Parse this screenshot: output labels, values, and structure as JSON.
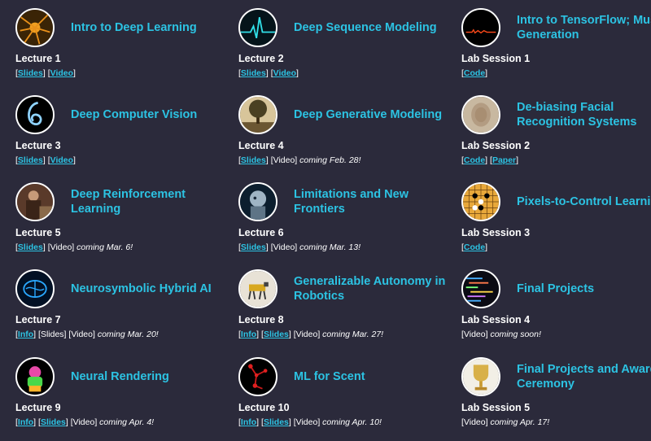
{
  "cards": [
    {
      "title": "Intro to Deep Learning",
      "session": "Lecture 1",
      "links": [
        {
          "kind": "link",
          "label": "Slides"
        },
        {
          "kind": "link",
          "label": "Video"
        }
      ],
      "note": ""
    },
    {
      "title": "Deep Sequence Modeling",
      "session": "Lecture 2",
      "links": [
        {
          "kind": "link",
          "label": "Slides"
        },
        {
          "kind": "link",
          "label": "Video"
        }
      ],
      "note": ""
    },
    {
      "title": "Intro to TensorFlow; Music Generation",
      "session": "Lab Session 1",
      "links": [
        {
          "kind": "link",
          "label": "Code"
        }
      ],
      "note": ""
    },
    {
      "title": "Deep Computer Vision",
      "session": "Lecture 3",
      "links": [
        {
          "kind": "link",
          "label": "Slides"
        },
        {
          "kind": "link",
          "label": "Video"
        }
      ],
      "note": ""
    },
    {
      "title": "Deep Generative Modeling",
      "session": "Lecture 4",
      "links": [
        {
          "kind": "link",
          "label": "Slides"
        },
        {
          "kind": "text",
          "label": "Video"
        }
      ],
      "note": "coming Feb. 28!"
    },
    {
      "title": "De-biasing Facial Recognition Systems",
      "session": "Lab Session 2",
      "links": [
        {
          "kind": "link",
          "label": "Code"
        },
        {
          "kind": "link",
          "label": "Paper"
        }
      ],
      "note": ""
    },
    {
      "title": "Deep Reinforcement Learning",
      "session": "Lecture 5",
      "links": [
        {
          "kind": "link",
          "label": "Slides"
        },
        {
          "kind": "text",
          "label": "Video"
        }
      ],
      "note": "coming Mar. 6!"
    },
    {
      "title": "Limitations and New Frontiers",
      "session": "Lecture 6",
      "links": [
        {
          "kind": "link",
          "label": "Slides"
        },
        {
          "kind": "text",
          "label": "Video"
        }
      ],
      "note": "coming Mar. 13!"
    },
    {
      "title": "Pixels-to-Control Learning",
      "session": "Lab Session 3",
      "links": [
        {
          "kind": "link",
          "label": "Code"
        }
      ],
      "note": ""
    },
    {
      "title": "Neurosymbolic Hybrid AI",
      "session": "Lecture 7",
      "links": [
        {
          "kind": "link",
          "label": "Info"
        },
        {
          "kind": "text",
          "label": "Slides"
        },
        {
          "kind": "text",
          "label": "Video"
        }
      ],
      "note": "coming Mar. 20!"
    },
    {
      "title": "Generalizable Autonomy in Robotics",
      "session": "Lecture 8",
      "links": [
        {
          "kind": "link",
          "label": "Info"
        },
        {
          "kind": "link",
          "label": "Slides"
        },
        {
          "kind": "text",
          "label": "Video"
        }
      ],
      "note": "coming Mar. 27!"
    },
    {
      "title": "Final Projects",
      "session": "Lab Session 4",
      "links": [
        {
          "kind": "text",
          "label": "Video"
        }
      ],
      "note": "coming soon!"
    },
    {
      "title": "Neural Rendering",
      "session": "Lecture 9",
      "links": [
        {
          "kind": "link",
          "label": "Info"
        },
        {
          "kind": "link",
          "label": "Slides"
        },
        {
          "kind": "text",
          "label": "Video"
        }
      ],
      "note": "coming Apr. 4!"
    },
    {
      "title": "ML for Scent",
      "session": "Lecture 10",
      "links": [
        {
          "kind": "link",
          "label": "Info"
        },
        {
          "kind": "link",
          "label": "Slides"
        },
        {
          "kind": "text",
          "label": "Video"
        }
      ],
      "note": "coming Apr. 10!"
    },
    {
      "title": "Final Projects and Awards Ceremony",
      "session": "Lab Session 5",
      "links": [
        {
          "kind": "text",
          "label": "Video"
        }
      ],
      "note": "coming Apr. 17!"
    }
  ],
  "thumbnails": [
    "neuron-image",
    "heartbeat-image",
    "waveform-image",
    "swirl-image",
    "tree-painting-image",
    "blurred-face-image",
    "chess-player-image",
    "robot-head-image",
    "go-board-image",
    "brain-image",
    "robot-dog-image",
    "code-screen-image",
    "rendered-figure-image",
    "molecule-image",
    "trophy-image"
  ],
  "colors": {
    "background": "#2b2a3b",
    "accent": "#2cc3e3",
    "text": "#ffffff"
  }
}
